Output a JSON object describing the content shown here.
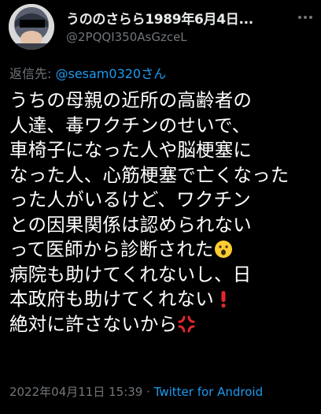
{
  "tweet": {
    "display_name": "うののさらら1989年6月4日...",
    "handle": "@2PQQI350AsGzceL",
    "reply_prefix": "返信先: ",
    "reply_mention": "@sesam0320さん",
    "body_lines": [
      "うちの母親の近所の高齢者の",
      "人達、毒ワクチンのせいで、",
      "車椅子になった人や脳梗塞に",
      "なった人、心筋梗塞で亡くなった",
      "った人がいるけど、ワクチン",
      "との因果関係は認められない",
      "って医師から診断された",
      "病院も助けてくれないし、日",
      "本政府も助けてくれない",
      "絶対に許さないから"
    ],
    "timestamp": "2022年04月11日 15:39",
    "separator": " · ",
    "source": "Twitter for Android"
  },
  "icons": {
    "more": "more-dots-icon",
    "avatar": "avatar",
    "surprised": "surprised-face-emoji",
    "exclamation": "red-exclamation-emoji",
    "anger": "anger-symbol-emoji"
  },
  "colors": {
    "background": "#000000",
    "text": "#ffffff",
    "muted": "#71767b",
    "link": "#1d9bf0"
  }
}
